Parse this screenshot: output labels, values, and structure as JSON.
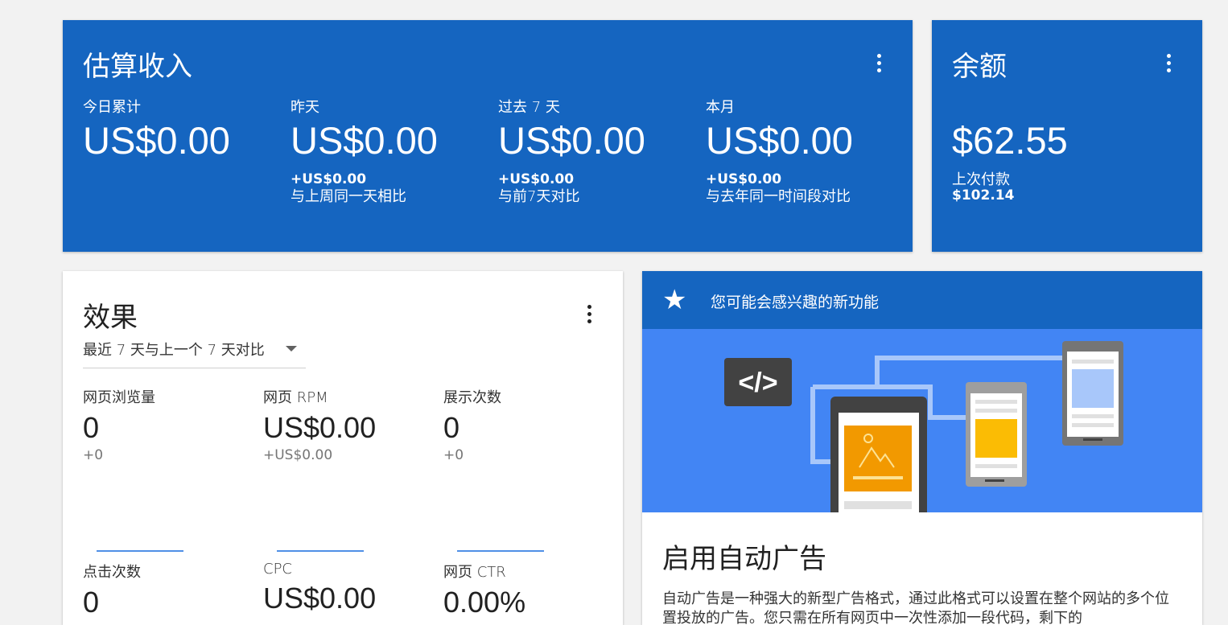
{
  "earnings": {
    "title": "估算收入",
    "columns": [
      {
        "label": "今日累计",
        "value": "US$0.00",
        "delta": "",
        "compare": ""
      },
      {
        "label": "昨天",
        "value": "US$0.00",
        "delta": "+US$0.00",
        "compare": "与上周同一天相比"
      },
      {
        "label": "过去 7 天",
        "value": "US$0.00",
        "delta": "+US$0.00",
        "compare": "与前7天对比"
      },
      {
        "label": "本月",
        "value": "US$0.00",
        "delta": "+US$0.00",
        "compare": "与去年同一时间段对比"
      }
    ]
  },
  "balance": {
    "title": "余额",
    "value": "$62.55",
    "last_payment_label": "上次付款",
    "last_payment_value": "$102.14"
  },
  "performance": {
    "title": "效果",
    "range": "最近 7 天与上一个 7 天对比",
    "metrics": [
      {
        "label": "网页浏览量",
        "value": "0",
        "delta": "+0"
      },
      {
        "label": "网页 RPM",
        "value": "US$0.00",
        "delta": "+US$0.00"
      },
      {
        "label": "展示次数",
        "value": "0",
        "delta": "+0"
      },
      {
        "label": "点击次数",
        "value": "0",
        "delta": ""
      },
      {
        "label": "CPC",
        "value": "US$0.00",
        "delta": ""
      },
      {
        "label": "网页 CTR",
        "value": "0.00%",
        "delta": ""
      }
    ]
  },
  "feature": {
    "header": "您可能会感兴趣的新功能",
    "code_symbol": "</>",
    "title": "启用自动广告",
    "body": "自动广告是一种强大的新型广告格式，通过此格式可以设置在整个网站的多个位置投放的广告。您只需在所有网页中一次性添加一段代码，剩下的"
  },
  "colors": {
    "primary": "#1565c0",
    "illustration_bg": "#4285f4",
    "accent_orange": "#f29900",
    "accent_yellow": "#fbbc04"
  }
}
